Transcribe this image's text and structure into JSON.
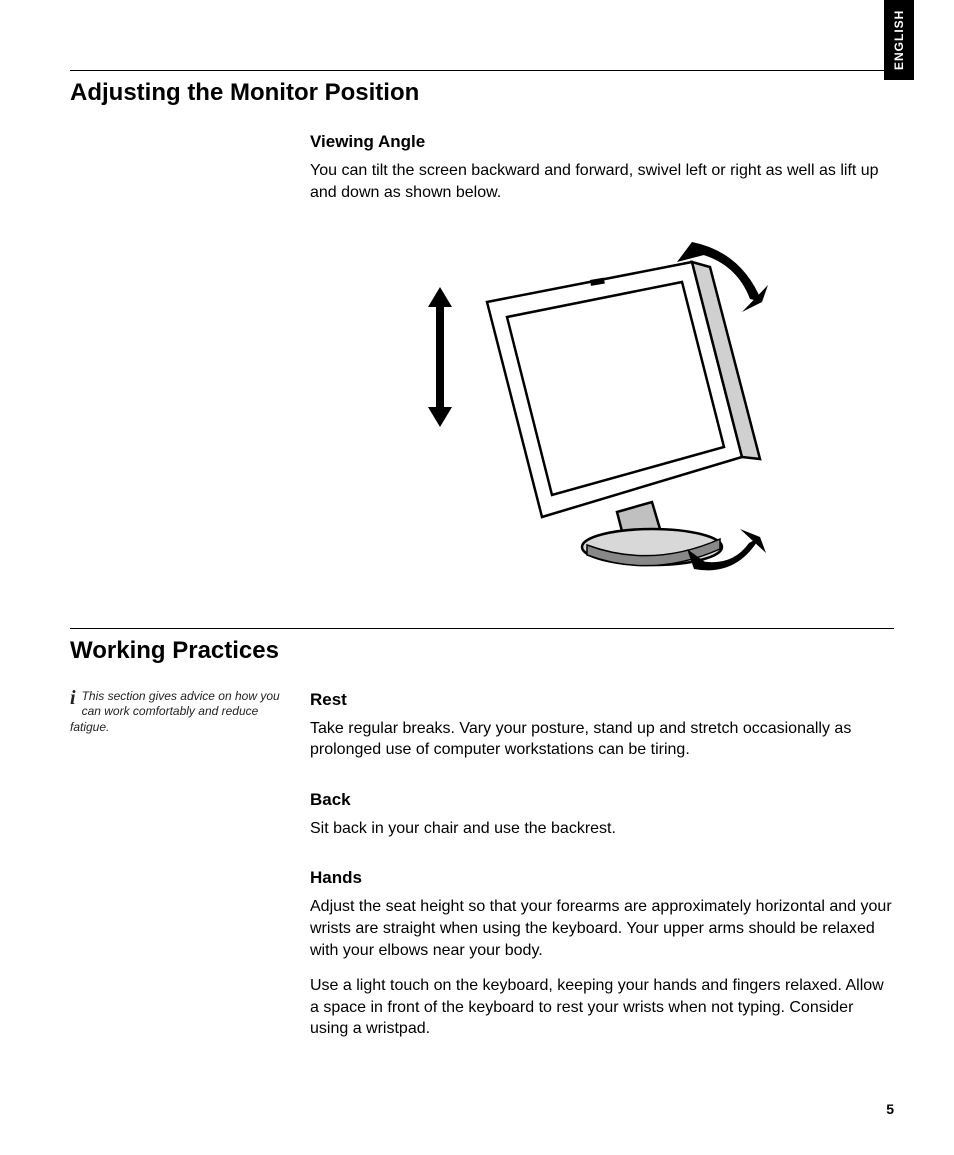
{
  "lang_tab": "ENGLISH",
  "page_number": "5",
  "section1": {
    "title": "Adjusting the Monitor Position",
    "viewing_angle": {
      "heading": "Viewing Angle",
      "body": "You can tilt the screen backward and forward, swivel left or right as well as lift up and down as shown below."
    }
  },
  "section2": {
    "title": "Working Practices",
    "sidebar_note": "This section gives advice on how you can work comfortably and reduce fatigue.",
    "rest": {
      "heading": "Rest",
      "body": "Take regular breaks. Vary your posture, stand up and stretch occasionally as prolonged use of computer workstations can be tiring."
    },
    "back": {
      "heading": "Back",
      "body": "Sit back in your chair and use the backrest."
    },
    "hands": {
      "heading": "Hands",
      "p1": "Adjust the seat height so that your forearms are approximately horizontal and your wrists are straight when using the keyboard. Your upper arms should be relaxed with your elbows near your body.",
      "p2": "Use a light touch on the keyboard, keeping your hands and fingers relaxed. Allow a space in front of the keyboard to rest your wrists when not typing. Consider using a wristpad."
    }
  }
}
